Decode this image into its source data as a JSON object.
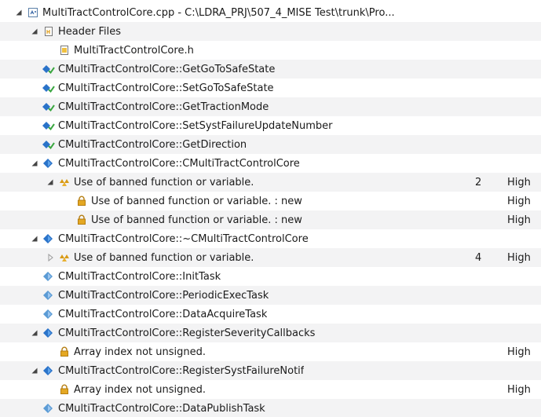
{
  "rows": [
    {
      "indent": 18,
      "toggle": "expanded",
      "icon": "cpp-file-icon",
      "label": "MultiTractControlCore.cpp - C:\\LDRA_PRJ\\507_4_MISE Test\\trunk\\Pro..."
    },
    {
      "indent": 38,
      "toggle": "expanded",
      "icon": "header-folder-icon",
      "label": "Header Files"
    },
    {
      "indent": 58,
      "toggle": "none",
      "icon": "header-file-icon",
      "label": "MultiTractControlCore.h"
    },
    {
      "indent": 38,
      "toggle": "none",
      "icon": "method-ok-icon",
      "label": "CMultiTractControlCore::GetGoToSafeState"
    },
    {
      "indent": 38,
      "toggle": "none",
      "icon": "method-ok-icon",
      "label": "CMultiTractControlCore::SetGoToSafeState"
    },
    {
      "indent": 38,
      "toggle": "none",
      "icon": "method-ok-icon",
      "label": "CMultiTractControlCore::GetTractionMode"
    },
    {
      "indent": 38,
      "toggle": "none",
      "icon": "method-ok-icon",
      "label": "CMultiTractControlCore::SetSystFailureUpdateNumber"
    },
    {
      "indent": 38,
      "toggle": "none",
      "icon": "method-ok-icon",
      "label": "CMultiTractControlCore::GetDirection"
    },
    {
      "indent": 38,
      "toggle": "expanded",
      "icon": "method-violation-icon",
      "label": "CMultiTractControlCore::CMultiTractControlCore"
    },
    {
      "indent": 58,
      "toggle": "expanded",
      "icon": "warning-group-icon",
      "label": "Use of banned function or variable.",
      "count": "2",
      "severity": "High"
    },
    {
      "indent": 80,
      "toggle": "none",
      "icon": "lock-warning-icon",
      "label": "Use of banned function or variable. : new",
      "severity": "High"
    },
    {
      "indent": 80,
      "toggle": "none",
      "icon": "lock-warning-icon",
      "label": "Use of banned function or variable. : new",
      "severity": "High"
    },
    {
      "indent": 38,
      "toggle": "expanded",
      "icon": "method-violation-icon",
      "label": "CMultiTractControlCore::~CMultiTractControlCore"
    },
    {
      "indent": 58,
      "toggle": "collapsed",
      "icon": "warning-group-icon",
      "label": "Use of banned function or variable.",
      "count": "4",
      "severity": "High"
    },
    {
      "indent": 38,
      "toggle": "none",
      "icon": "method-icon",
      "label": "CMultiTractControlCore::InitTask"
    },
    {
      "indent": 38,
      "toggle": "none",
      "icon": "method-icon",
      "label": "CMultiTractControlCore::PeriodicExecTask"
    },
    {
      "indent": 38,
      "toggle": "none",
      "icon": "method-icon",
      "label": "CMultiTractControlCore::DataAcquireTask"
    },
    {
      "indent": 38,
      "toggle": "expanded",
      "icon": "method-violation-icon",
      "label": "CMultiTractControlCore::RegisterSeverityCallbacks"
    },
    {
      "indent": 58,
      "toggle": "none",
      "icon": "lock-warning-icon",
      "label": "Array index not unsigned.",
      "severity": "High"
    },
    {
      "indent": 38,
      "toggle": "expanded",
      "icon": "method-violation-icon",
      "label": "CMultiTractControlCore::RegisterSystFailureNotif"
    },
    {
      "indent": 58,
      "toggle": "none",
      "icon": "lock-warning-icon",
      "label": "Array index not unsigned.",
      "severity": "High"
    },
    {
      "indent": 38,
      "toggle": "none",
      "icon": "method-icon",
      "label": "CMultiTractControlCore::DataPublishTask"
    }
  ]
}
